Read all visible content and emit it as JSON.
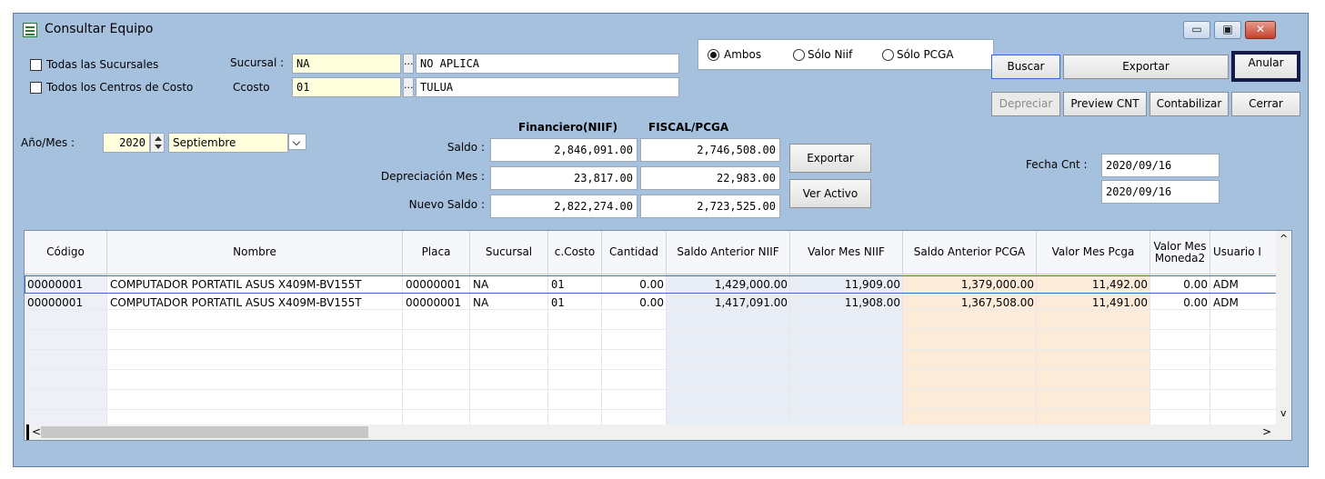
{
  "window": {
    "title": "Consultar Equipo",
    "controls": [
      "▭",
      "▣",
      "✕"
    ]
  },
  "filters": {
    "todas_sucursales": "Todas las Sucursales",
    "todos_centros": "Todos los Centros de Costo",
    "sucursal_label": "Sucursal :",
    "sucursal_code": "NA",
    "sucursal_name": "NO APLICA",
    "ccosto_label": "Ccosto",
    "ccosto_code": "01",
    "ccosto_name": "TULUA",
    "dots": "..."
  },
  "radios": {
    "ambos": "Ambos",
    "solo_niif": "Sólo Niif",
    "solo_pcga": "Sólo PCGA",
    "selected": "ambos"
  },
  "buttons": {
    "buscar": "Buscar",
    "exportar_top": "Exportar",
    "anular": "Anular",
    "depreciar": "Depreciar",
    "preview": "Preview CNT",
    "contabilizar": "Contabilizar",
    "cerrar": "Cerrar",
    "exportar_mid": "Exportar",
    "ver_activo": "Ver Activo"
  },
  "period": {
    "label": "Año/Mes :",
    "year": "2020",
    "month": "Septiembre"
  },
  "summary": {
    "hdr_niif": "Financiero(NIIF)",
    "hdr_fiscal": "FISCAL/PCGA",
    "saldo_label": "Saldo :",
    "dep_label": "Depreciación Mes :",
    "nuevo_label": "Nuevo Saldo :",
    "niif_saldo": "2,846,091.00",
    "niif_dep": "23,817.00",
    "niif_nuevo": "2,822,274.00",
    "fiscal_saldo": "2,746,508.00",
    "fiscal_dep": "22,983.00",
    "fiscal_nuevo": "2,723,525.00"
  },
  "fecha": {
    "label": "Fecha Cnt :",
    "date1": "2020/09/16",
    "date2": "2020/09/16"
  },
  "grid": {
    "headers": [
      "Código",
      "Nombre",
      "Placa",
      "Sucursal",
      "c.Costo",
      "Cantidad",
      "Saldo Anterior NIIF",
      "Valor Mes NIIF",
      "Saldo Anterior PCGA",
      "Valor Mes Pcga",
      "Valor Mes Moneda2",
      "Usuario I"
    ],
    "rows": [
      [
        "00000001",
        "COMPUTADOR PORTATIL ASUS X409M-BV155T",
        "00000001",
        "NA",
        "01",
        "0.00",
        "1,429,000.00",
        "11,909.00",
        "1,379,000.00",
        "11,492.00",
        "0.00",
        "ADM"
      ],
      [
        "00000001",
        "COMPUTADOR PORTATIL ASUS X409M-BV155T",
        "00000001",
        "NA",
        "01",
        "0.00",
        "1,417,091.00",
        "11,908.00",
        "1,367,508.00",
        "11,491.00",
        "0.00",
        "ADM"
      ]
    ],
    "colors": {
      "niif_band": "#e9edf5",
      "pcga_band": "#fdebd9",
      "code_band": "#edf1f7"
    },
    "scroll_left": "<",
    "scroll_right": ">",
    "scroll_up": "^",
    "scroll_down": "v"
  }
}
